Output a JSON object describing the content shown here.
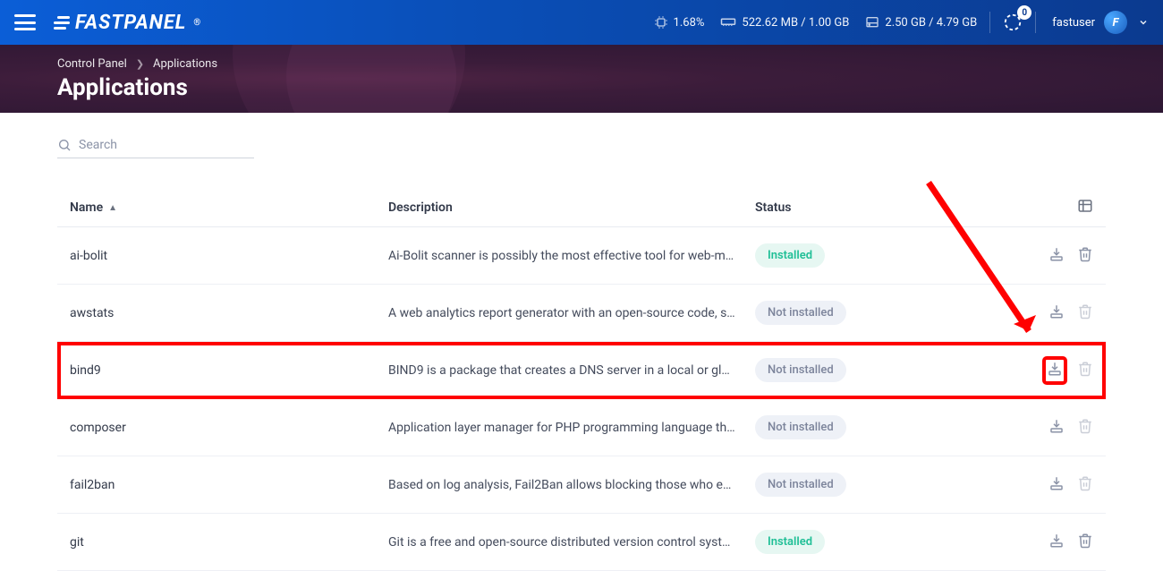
{
  "topbar": {
    "cpu": "1.68%",
    "ram": "522.62 MB / 1.00 GB",
    "disk": "2.50 GB / 4.79 GB",
    "tasks_badge": "0",
    "username": "fastuser",
    "logo_text": "FASTPANEL"
  },
  "breadcrumb": {
    "root": "Control Panel",
    "current": "Applications"
  },
  "page_title": "Applications",
  "search": {
    "placeholder": "Search"
  },
  "columns": {
    "name": "Name",
    "description": "Description",
    "status": "Status"
  },
  "status_labels": {
    "installed": "Installed",
    "not_installed": "Not installed"
  },
  "rows": [
    {
      "name": "ai-bolit",
      "desc": "Ai-Bolit scanner is possibly the most effective tool for web-m…",
      "installed": true,
      "highlight": false
    },
    {
      "name": "awstats",
      "desc": "A web analytics report generator with an open-source code, s…",
      "installed": false,
      "highlight": false
    },
    {
      "name": "bind9",
      "desc": "BIND9 is a package that creates a DNS server in a local or gl…",
      "installed": false,
      "highlight": true
    },
    {
      "name": "composer",
      "desc": "Application layer manager for PHP programming language th…",
      "installed": false,
      "highlight": false
    },
    {
      "name": "fail2ban",
      "desc": "Based on log analysis, Fail2Ban allows blocking those who e…",
      "installed": false,
      "highlight": false
    },
    {
      "name": "git",
      "desc": "Git is a free and open-source distributed version control syst…",
      "installed": true,
      "highlight": false
    }
  ]
}
